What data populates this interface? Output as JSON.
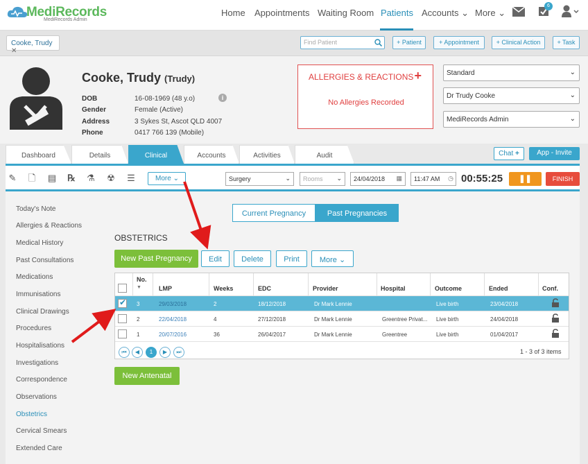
{
  "app": {
    "logo": "MediRecords",
    "logo_sub": "MediRecords Admin"
  },
  "nav": {
    "home": "Home",
    "appointments": "Appointments",
    "waiting": "Waiting Room",
    "patients": "Patients",
    "accounts": "Accounts",
    "more": "More",
    "tasks_badge": "6"
  },
  "bar": {
    "patient_tab": "Cooke, Trudy",
    "find_placeholder": "Find Patient",
    "add_patient": "+ Patient",
    "add_appointment": "+ Appointment",
    "add_clinical": "+ Clinical Action",
    "add_task": "+ Task"
  },
  "patient": {
    "name": "Cooke, Trudy",
    "nickname": "(Trudy)",
    "dob_label": "DOB",
    "dob": "16-08-1969 (48 y.o)",
    "gender_label": "Gender",
    "gender": "Female (Active)",
    "address_label": "Address",
    "address": "3 Sykes St, Ascot QLD 4007",
    "phone_label": "Phone",
    "phone": "0417 766 139 (Mobile)"
  },
  "allergies": {
    "title": "ALLERGIES & REACTIONS",
    "plus": "+",
    "none": "No Allergies Recorded"
  },
  "selects": {
    "billing": "Standard",
    "doctor": "Dr Trudy Cooke",
    "admin": "MediRecords Admin"
  },
  "tabs": [
    "Dashboard",
    "Details",
    "Clinical",
    "Accounts",
    "Activities",
    "Audit"
  ],
  "actions": {
    "chat": "Chat",
    "invite": "App - Invite"
  },
  "toolbar": {
    "more": "More",
    "location": "Surgery",
    "rooms": "Rooms",
    "date": "24/04/2018",
    "time": "11:47 AM",
    "timer": "00:55:25",
    "pause": "❚❚",
    "finish": "FINISH"
  },
  "sidebar": [
    "Today's Note",
    "Allergies & Reactions",
    "Medical History",
    "Past Consultations",
    "Medications",
    "Immunisations",
    "Clinical Drawings",
    "Procedures",
    "Hospitalisations",
    "Investigations",
    "Correspondence",
    "Observations",
    "Obstetrics",
    "Cervical Smears",
    "Extended Care"
  ],
  "pregnancy_toggle": {
    "current": "Current Pregnancy",
    "past": "Past Pregnancies"
  },
  "obstetrics": {
    "title": "OBSTETRICS",
    "new_past": "New Past Pregnancy",
    "edit": "Edit",
    "delete": "Delete",
    "print": "Print",
    "more": "More",
    "new_antenatal": "New Antenatal"
  },
  "grid": {
    "headers": {
      "no": "No.",
      "lmp": "LMP",
      "weeks": "Weeks",
      "edc": "EDC",
      "provider": "Provider",
      "hospital": "Hospital",
      "outcome": "Outcome",
      "ended": "Ended",
      "conf": "Conf."
    },
    "rows": [
      {
        "no": "3",
        "lmp": "29/03/2018",
        "weeks": "2",
        "edc": "18/12/2018",
        "provider": "Dr Mark Lennie",
        "hospital": "",
        "outcome": "Live birth",
        "ended": "23/04/2018",
        "checked": true
      },
      {
        "no": "2",
        "lmp": "22/04/2018",
        "weeks": "4",
        "edc": "27/12/2018",
        "provider": "Dr Mark Lennie",
        "hospital": "Greentree Privat...",
        "outcome": "Live birth",
        "ended": "24/04/2018",
        "checked": false
      },
      {
        "no": "1",
        "lmp": "20/07/2016",
        "weeks": "36",
        "edc": "26/04/2017",
        "provider": "Dr Mark Lennie",
        "hospital": "Greentree",
        "outcome": "Live birth",
        "ended": "01/04/2017",
        "checked": false
      }
    ],
    "page": "1",
    "summary": "1 - 3 of 3 items"
  }
}
